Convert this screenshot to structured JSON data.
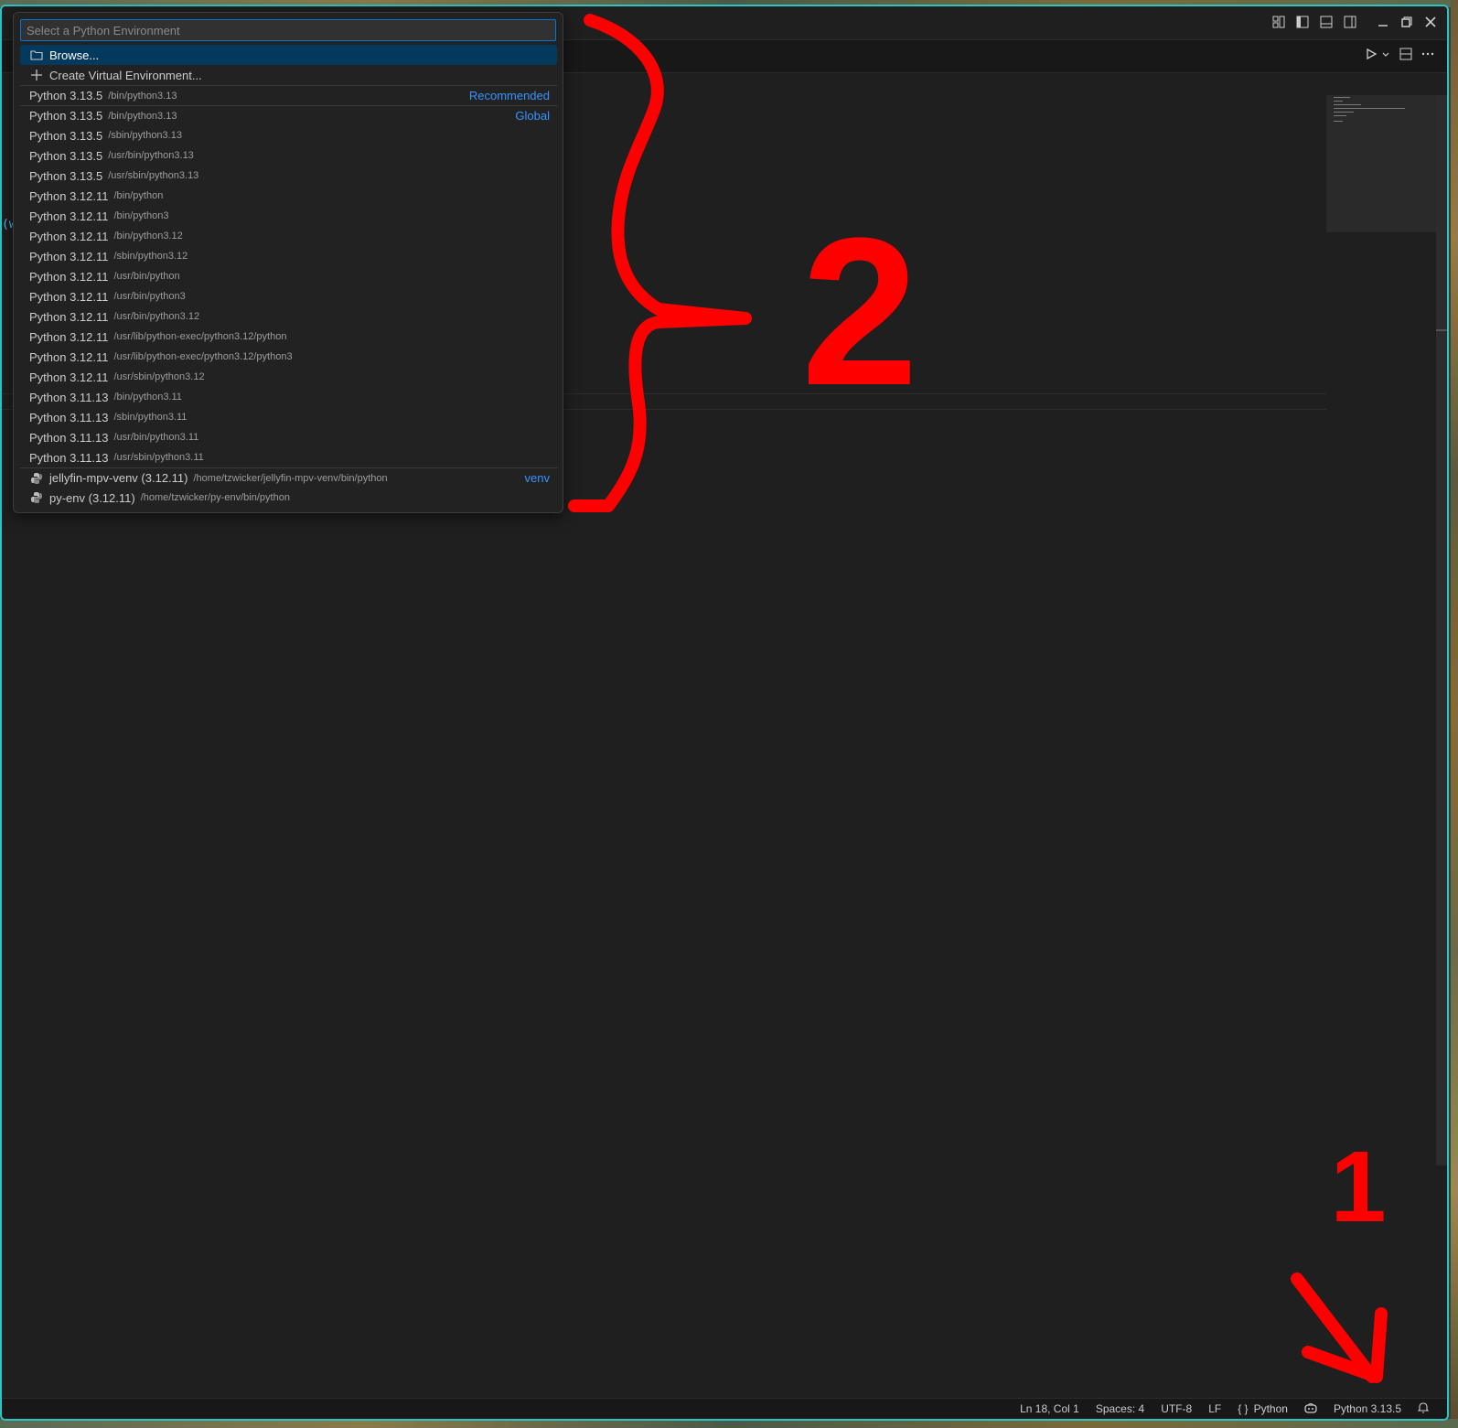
{
  "quickpick": {
    "placeholder": "Select a Python Environment",
    "actions": [
      {
        "label": "Browse...",
        "icon": "folder-icon"
      },
      {
        "label": "Create Virtual Environment...",
        "icon": "plus-icon"
      }
    ],
    "interpreters": [
      {
        "name": "Python 3.13.5",
        "path": "/bin/python3.13",
        "tag": "Recommended"
      },
      {
        "name": "Python 3.13.5",
        "path": "/bin/python3.13",
        "tag": "Global"
      },
      {
        "name": "Python 3.13.5",
        "path": "/sbin/python3.13",
        "tag": ""
      },
      {
        "name": "Python 3.13.5",
        "path": "/usr/bin/python3.13",
        "tag": ""
      },
      {
        "name": "Python 3.13.5",
        "path": "/usr/sbin/python3.13",
        "tag": ""
      },
      {
        "name": "Python 3.12.11",
        "path": "/bin/python",
        "tag": ""
      },
      {
        "name": "Python 3.12.11",
        "path": "/bin/python3",
        "tag": ""
      },
      {
        "name": "Python 3.12.11",
        "path": "/bin/python3.12",
        "tag": ""
      },
      {
        "name": "Python 3.12.11",
        "path": "/sbin/python3.12",
        "tag": ""
      },
      {
        "name": "Python 3.12.11",
        "path": "/usr/bin/python",
        "tag": ""
      },
      {
        "name": "Python 3.12.11",
        "path": "/usr/bin/python3",
        "tag": ""
      },
      {
        "name": "Python 3.12.11",
        "path": "/usr/bin/python3.12",
        "tag": ""
      },
      {
        "name": "Python 3.12.11",
        "path": "/usr/lib/python-exec/python3.12/python",
        "tag": ""
      },
      {
        "name": "Python 3.12.11",
        "path": "/usr/lib/python-exec/python3.12/python3",
        "tag": ""
      },
      {
        "name": "Python 3.12.11",
        "path": "/usr/sbin/python3.12",
        "tag": ""
      },
      {
        "name": "Python 3.11.13",
        "path": "/bin/python3.11",
        "tag": ""
      },
      {
        "name": "Python 3.11.13",
        "path": "/sbin/python3.11",
        "tag": ""
      },
      {
        "name": "Python 3.11.13",
        "path": "/usr/bin/python3.11",
        "tag": ""
      },
      {
        "name": "Python 3.11.13",
        "path": "/usr/sbin/python3.11",
        "tag": ""
      }
    ],
    "venvs": [
      {
        "name": "jellyfin-mpv-venv (3.12.11)",
        "path": "/home/tzwicker/jellyfin-mpv-venv/bin/python",
        "tag": "venv"
      },
      {
        "name": "py-env (3.12.11)",
        "path": "/home/tzwicker/py-env/bin/python",
        "tag": ""
      }
    ]
  },
  "editor": {
    "code_fragment": "(w"
  },
  "statusbar": {
    "position": "Ln 18, Col 1",
    "spaces": "Spaces: 4",
    "encoding": "UTF-8",
    "eol": "LF",
    "language_icon": "{ }",
    "language": "Python",
    "interpreter": "Python 3.13.5"
  },
  "annotations": {
    "label_one": "1",
    "label_two": "2"
  },
  "colors": {
    "accent": "#0078d4",
    "selection": "#04395e",
    "tag_blue": "#3794ff",
    "annotation_red": "#ff0000",
    "window_border": "#2ec4c4"
  }
}
